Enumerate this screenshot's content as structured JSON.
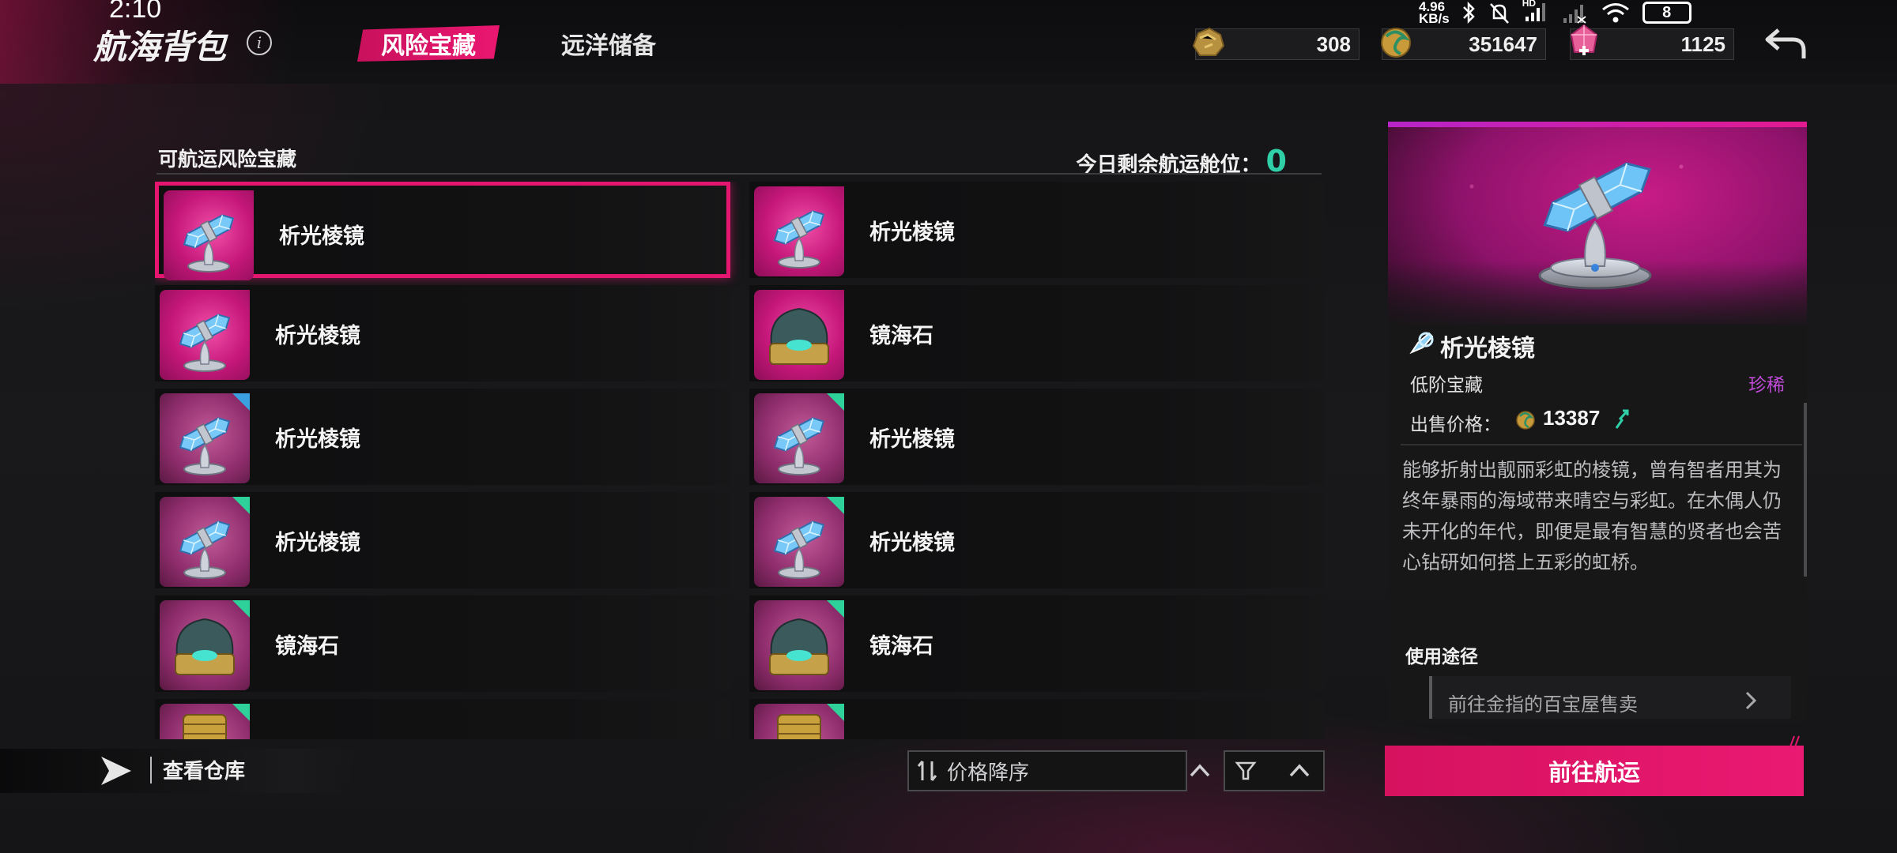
{
  "status_bar": {
    "time": "2:10",
    "net_speed_value": "4.96",
    "net_speed_unit": "KB/s",
    "signal_hd": "HD",
    "battery": "8"
  },
  "header": {
    "title": "航海背包",
    "tabs": [
      {
        "label": "风险宝藏",
        "active": true
      },
      {
        "label": "远洋储备",
        "active": false
      }
    ],
    "currencies": [
      {
        "icon": "ore-icon",
        "value": "308"
      },
      {
        "icon": "coin-dragon-icon",
        "value": "351647"
      },
      {
        "icon": "pink-crystal-icon",
        "value": "1125"
      }
    ]
  },
  "list": {
    "header": "可航运风险宝藏",
    "slots_label": "今日剩余航运舱位：",
    "slots_value": "0",
    "items": [
      {
        "name": "析光棱镜",
        "icon": "prism-icon",
        "corner": "none",
        "selected": true
      },
      {
        "name": "析光棱镜",
        "icon": "prism-icon",
        "corner": "none",
        "selected": false
      },
      {
        "name": "析光棱镜",
        "icon": "prism-icon",
        "corner": "none",
        "selected": false
      },
      {
        "name": "镜海石",
        "icon": "shell-gem-icon",
        "corner": "none",
        "selected": false
      },
      {
        "name": "析光棱镜",
        "icon": "prism-icon",
        "corner": "#3aa0e0",
        "selected": false
      },
      {
        "name": "析光棱镜",
        "icon": "prism-icon",
        "corner": "#2ed19a",
        "selected": false
      },
      {
        "name": "析光棱镜",
        "icon": "prism-icon",
        "corner": "#2ed19a",
        "selected": false
      },
      {
        "name": "析光棱镜",
        "icon": "prism-icon",
        "corner": "#2ed19a",
        "selected": false
      },
      {
        "name": "镜海石",
        "icon": "shell-gem-icon",
        "corner": "#2ed19a",
        "selected": false
      },
      {
        "name": "镜海石",
        "icon": "shell-gem-icon",
        "corner": "#2ed19a",
        "selected": false
      },
      {
        "name": "",
        "icon": "gold-cylinder-icon",
        "corner": "#2ed19a",
        "selected": false
      },
      {
        "name": "",
        "icon": "gold-cylinder-icon",
        "corner": "#2ed19a",
        "selected": false
      }
    ]
  },
  "bottom": {
    "warehouse_label": "查看仓库",
    "sort_label": "价格降序"
  },
  "detail": {
    "name": "析光棱镜",
    "type": "低阶宝藏",
    "rarity": "珍稀",
    "price_label": "出售价格：",
    "price_value": "13387",
    "description": "能够折射出靓丽彩虹的棱镜，曾有智者用其为终年暴雨的海域带来晴空与彩虹。在木偶人仍未开化的年代，即便是最有智慧的贤者也会苦心钻研如何搭上五彩的虹桥。",
    "usage_title": "使用途径",
    "usage_link": "前往金指的百宝屋售卖",
    "action_button": "前往航运"
  },
  "colors": {
    "accent_pink": "#e5166f",
    "rarity_purple": "#c04bd9",
    "slots_green": "#2fd0a7"
  }
}
